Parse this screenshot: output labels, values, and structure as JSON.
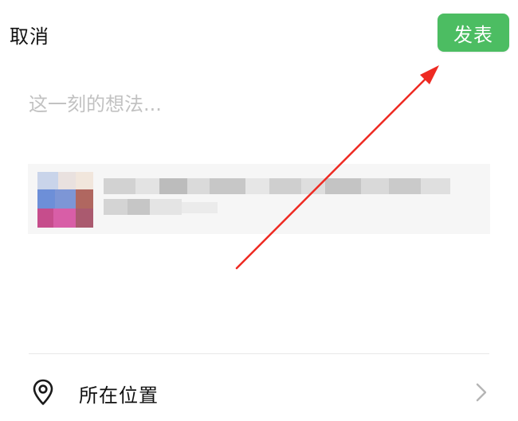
{
  "header": {
    "cancel_label": "取消",
    "publish_label": "发表"
  },
  "composer": {
    "placeholder": "这一刻的想法..."
  },
  "location": {
    "label": "所在位置",
    "icon": "location-pin-icon",
    "chevron_icon": "chevron-right-icon"
  },
  "colors": {
    "accent": "#4cbd62",
    "arrow": "#ee2a22"
  }
}
